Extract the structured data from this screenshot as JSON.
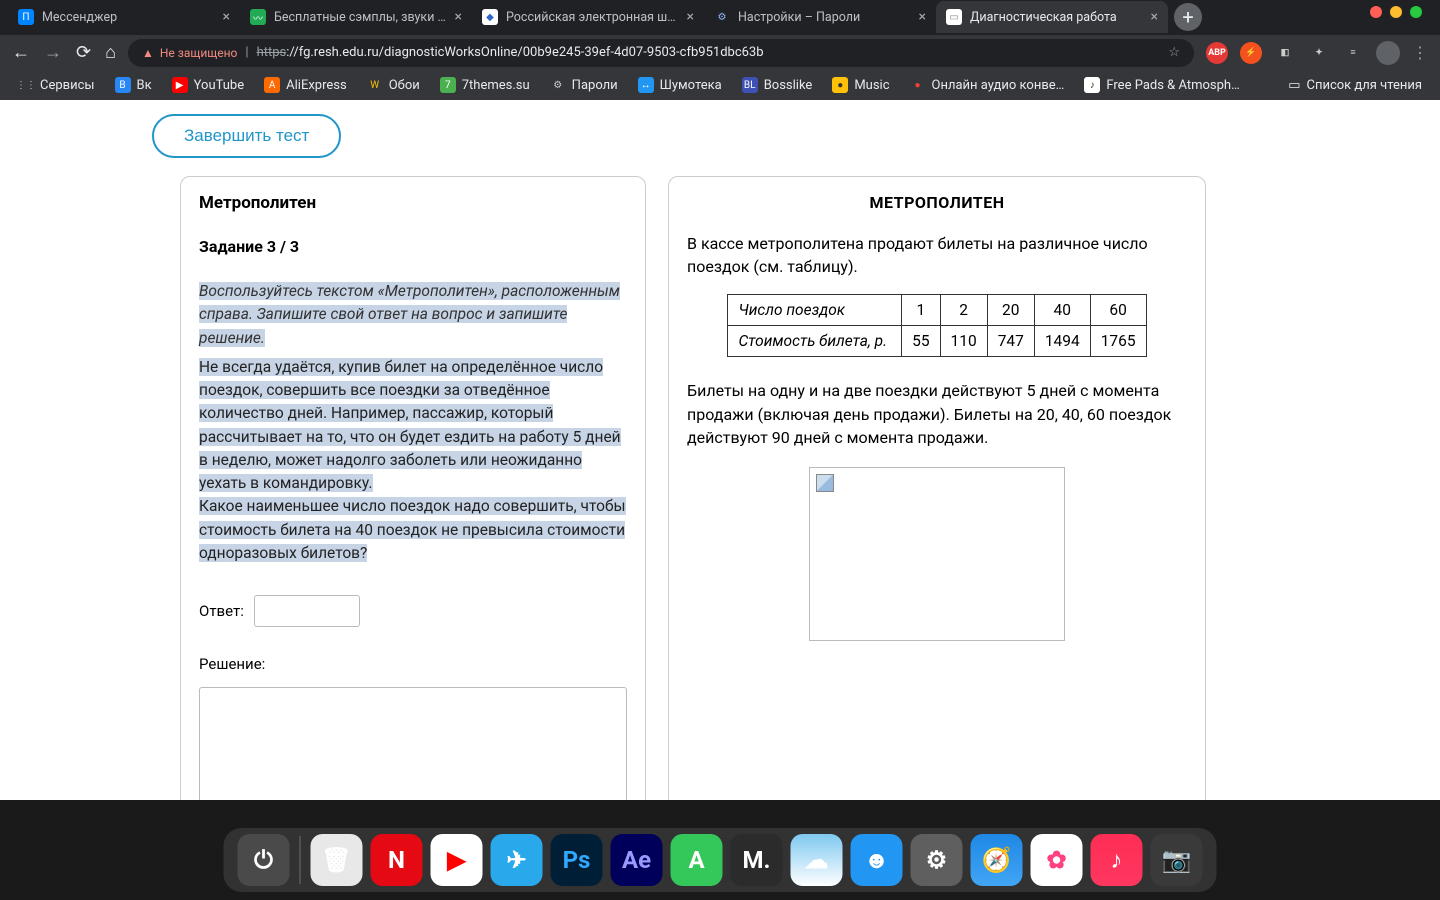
{
  "tabs": [
    {
      "title": "Мессенджер",
      "favicon": "П",
      "faviconBg": "#0084ff",
      "faviconColor": "#fff"
    },
    {
      "title": "Бесплатные сэмплы, звуки и лупы",
      "favicon": "〰",
      "faviconBg": "#2a5",
      "faviconColor": "#fff"
    },
    {
      "title": "Российская электронная школа",
      "favicon": "◆",
      "faviconBg": "#fff",
      "faviconColor": "#36c"
    },
    {
      "title": "Настройки – Пароли",
      "favicon": "⚙",
      "faviconBg": "transparent",
      "faviconColor": "#8ab4f8"
    },
    {
      "title": "Диагностическая работа",
      "favicon": "▭",
      "faviconBg": "#fff",
      "faviconColor": "#888"
    }
  ],
  "activeTabIndex": 4,
  "address": {
    "warn": "Не защищено",
    "scheme": "https",
    "rest": "://fg.resh.edu.ru/diagnosticWorksOnline/00b9e245-39ef-4d07-9503-cfb951dbc63b"
  },
  "extensions": [
    {
      "label": "ABP",
      "bg": "#e53935",
      "color": "#fff"
    },
    {
      "label": "⚡",
      "bg": "#f4511e",
      "color": "#fff"
    },
    {
      "label": "◧",
      "bg": "transparent",
      "color": "#ccc"
    },
    {
      "label": "✦",
      "bg": "transparent",
      "color": "#ccc"
    },
    {
      "label": "≡",
      "bg": "transparent",
      "color": "#ccc"
    }
  ],
  "bookmarks": [
    {
      "label": "Сервисы",
      "icon": "⋮⋮",
      "bg": "transparent",
      "color": "#ccc"
    },
    {
      "label": "Вк",
      "icon": "B",
      "bg": "#2787f5",
      "color": "#fff"
    },
    {
      "label": "YouTube",
      "icon": "▶",
      "bg": "#ff0000",
      "color": "#fff"
    },
    {
      "label": "AliExpress",
      "icon": "A",
      "bg": "#ff6a00",
      "color": "#fff"
    },
    {
      "label": "Обои",
      "icon": "W",
      "bg": "transparent",
      "color": "#ffc107"
    },
    {
      "label": "7themes.su",
      "icon": "7",
      "bg": "#4caf50",
      "color": "#fff"
    },
    {
      "label": "Пароли",
      "icon": "⚙",
      "bg": "transparent",
      "color": "#ccc"
    },
    {
      "label": "Шумотека",
      "icon": "↔",
      "bg": "#2196f3",
      "color": "#fff"
    },
    {
      "label": "Bosslike",
      "icon": "BL",
      "bg": "#3f51b5",
      "color": "#fff"
    },
    {
      "label": "Music",
      "icon": "●",
      "bg": "#ffc107",
      "color": "#333"
    },
    {
      "label": "Онлайн аудио конве…",
      "icon": "●",
      "bg": "transparent",
      "color": "#f44336"
    },
    {
      "label": "Free Pads & Atmosph…",
      "icon": "♪",
      "bg": "#fff",
      "color": "#333"
    }
  ],
  "readingList": "Список для чтения",
  "page": {
    "finish": "Завершить тест",
    "leftTitle": "Метрополитен",
    "taskLabel": "Задание 3 / 3",
    "instruction1": "Воспользуйтесь текстом «Метрополитен», расположенным справа. Запишите свой ответ на вопрос и запишите решение.",
    "para1": "Не всегда удаётся, купив билет на определённое число поездок, совершить все поездки за отведённое количество дней. Например, пассажир, который рассчитывает на то, что он будет ездить на работу 5 дней в неделю, может надолго заболеть или неожиданно уехать в командировку.",
    "para2": "Какое наименьшее число поездок надо совершить, чтобы стоимость билета на 40 поездок не превысила стоимости одноразовых билетов?",
    "answerLabel": "Ответ:",
    "solutionLabel": "Решение:",
    "rightTitle": "МЕТРОПОЛИТЕН",
    "rightIntro": "В кассе метрополитена продают билеты на различное число поездок (см. таблицу).",
    "tableRow1Label": "Число поездок",
    "tableRow2Label": "Стоимость билета, р.",
    "tableCols": [
      "1",
      "2",
      "20",
      "40",
      "60"
    ],
    "tablePrices": [
      "55",
      "110",
      "747",
      "1494",
      "1765"
    ],
    "rightBody": "Билеты на одну и на две поездки действуют 5 дней с момента продажи (включая день продажи). Билеты на 20, 40, 60 поездок действуют 90 дней с момента продажи."
  },
  "dock": [
    {
      "bg": "#4a4a4a",
      "char": "⏻"
    },
    {
      "bg": "#e8e8e8",
      "char": "🗑"
    },
    {
      "bg": "#e50914",
      "char": "N"
    },
    {
      "bg": "#ffffff",
      "char": "▶",
      "color": "#ff0000"
    },
    {
      "bg": "#29a9eb",
      "char": "✈"
    },
    {
      "bg": "#001e36",
      "char": "Ps",
      "color": "#31a8ff"
    },
    {
      "bg": "#00005b",
      "char": "Ae",
      "color": "#9999ff"
    },
    {
      "bg": "#34c759",
      "char": "А"
    },
    {
      "bg": "#2b2b2b",
      "char": "M."
    },
    {
      "bg": "linear-gradient(#7ec8f0,#fff)",
      "char": "☁"
    },
    {
      "bg": "#2196f3",
      "char": "☻"
    },
    {
      "bg": "#5f5f5f",
      "char": "⚙"
    },
    {
      "bg": "linear-gradient(#1e88e5,#42a5f5)",
      "char": "🧭"
    },
    {
      "bg": "#fff",
      "char": "✿",
      "color": "#ff4081"
    },
    {
      "bg": "linear-gradient(#ff2d55,#ff375f)",
      "char": "♪"
    },
    {
      "bg": "#3a3a3a",
      "char": "📷"
    }
  ]
}
